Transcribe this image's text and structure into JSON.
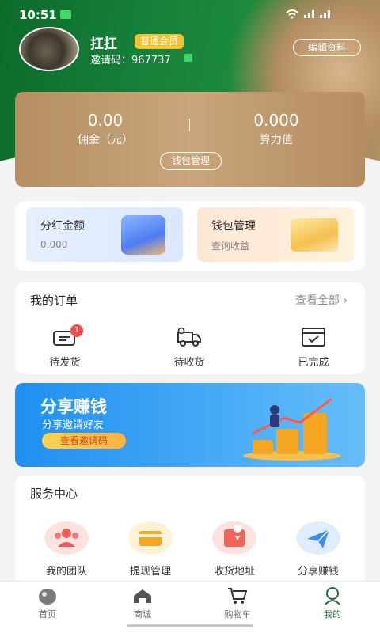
{
  "status": {
    "time": "10:51"
  },
  "profile": {
    "name": "扛扛",
    "level": "普通会员",
    "invite_label": "邀请码：",
    "invite_code": "967737",
    "edit_label": "编辑资料"
  },
  "wallet": {
    "commission_value": "0.00",
    "commission_label": "佣金（元）",
    "power_value": "0.000",
    "power_label": "算力值",
    "manage_label": "钱包管理"
  },
  "quick": [
    {
      "title": "分红金额",
      "subtitle": "0.000"
    },
    {
      "title": "钱包管理",
      "subtitle": "查询收益"
    }
  ],
  "orders": {
    "title": "我的订单",
    "view_all": "查看全部",
    "items": [
      {
        "label": "待发货",
        "badge": "1",
        "icon": "truck-box-icon"
      },
      {
        "label": "待收货",
        "icon": "delivery-truck-icon"
      },
      {
        "label": "已完成",
        "icon": "completed-box-icon"
      }
    ]
  },
  "banner": {
    "title": "分享赚钱",
    "subtitle": "分享邀请好友",
    "button": "查看邀请码"
  },
  "services": {
    "title": "服务中心",
    "items": [
      {
        "label": "我的团队",
        "icon": "team-icon",
        "color": "#f25b5b"
      },
      {
        "label": "提现管理",
        "icon": "card-icon",
        "color": "#f5a623"
      },
      {
        "label": "收货地址",
        "icon": "map-pin-icon",
        "color": "#f2645a"
      },
      {
        "label": "分享赚钱",
        "icon": "paper-plane-icon",
        "color": "#3d8df5"
      }
    ]
  },
  "tabbar": [
    {
      "label": "首页",
      "icon": "home-icon"
    },
    {
      "label": "商城",
      "icon": "shop-icon"
    },
    {
      "label": "购物车",
      "icon": "cart-icon"
    },
    {
      "label": "我的",
      "icon": "user-icon",
      "active": true
    }
  ]
}
